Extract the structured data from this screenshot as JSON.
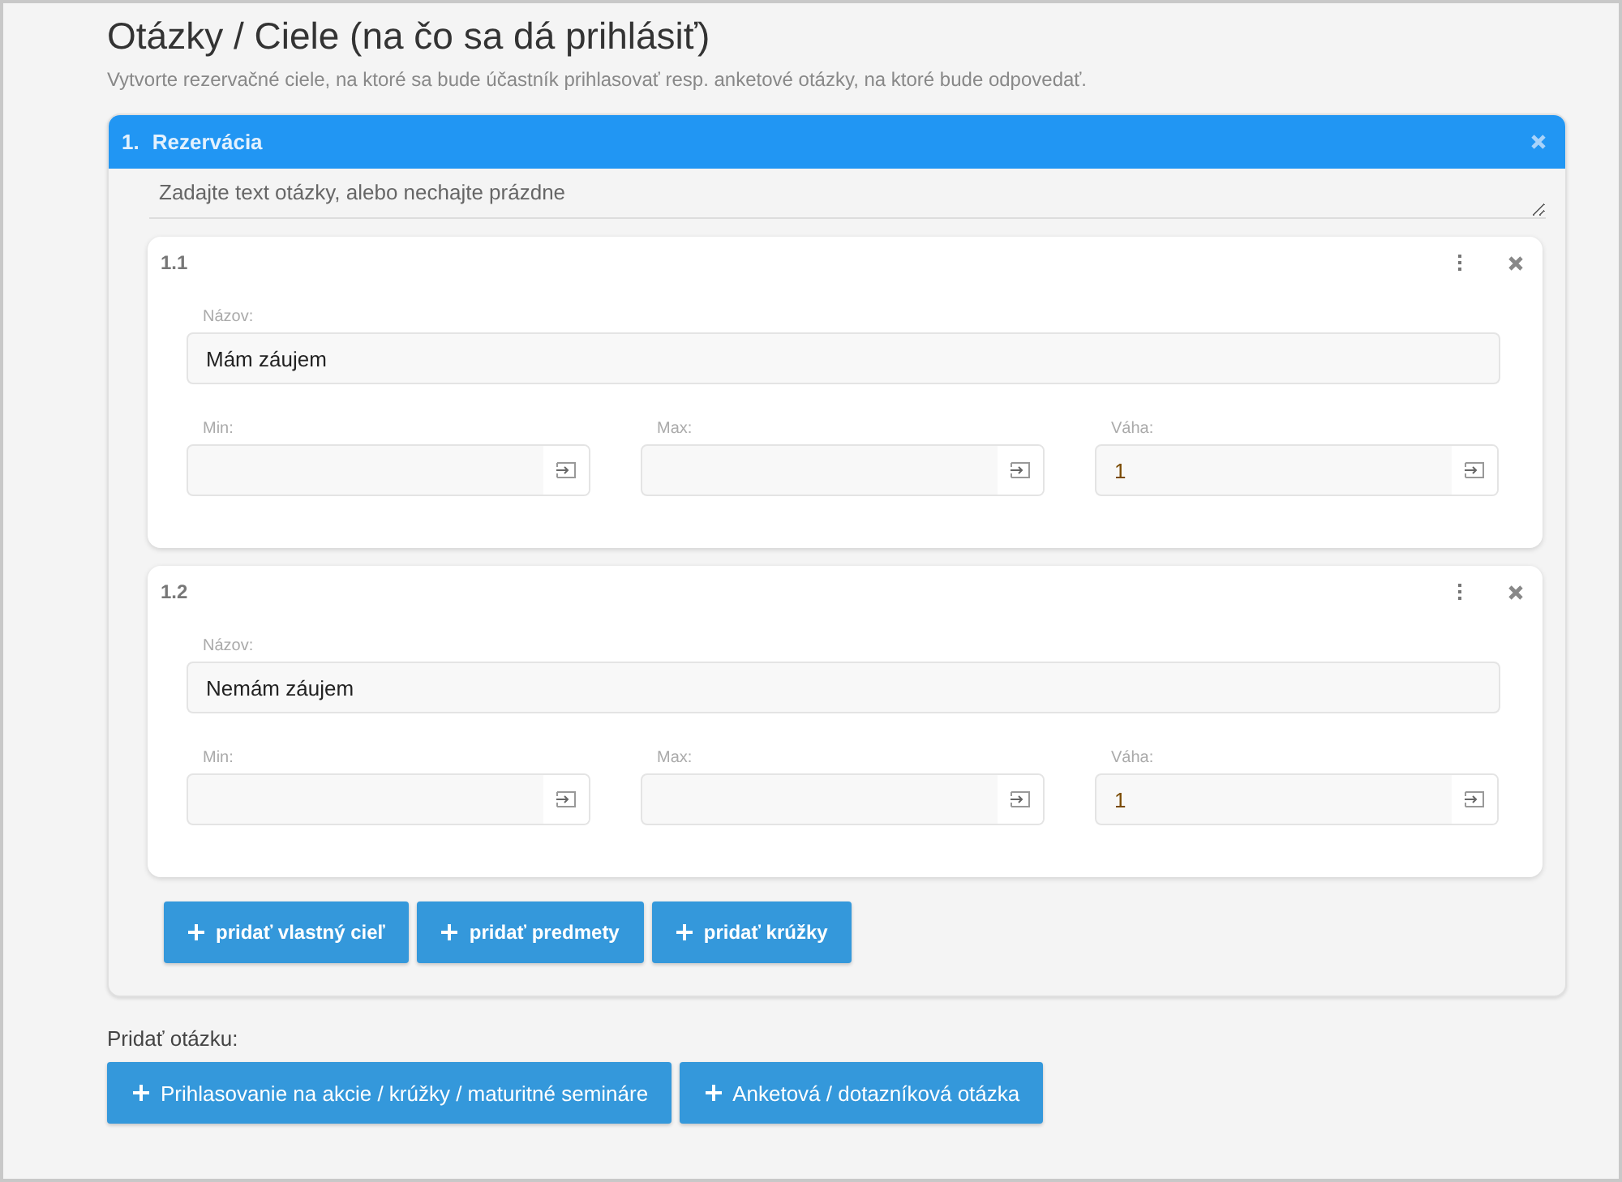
{
  "page": {
    "title": "Otázky / Ciele (na čo sa dá prihlásiť)",
    "subtitle": "Vytvorte rezervačné ciele, na ktoré sa bude účastník prihlasovať resp. anketové otázky, na ktoré bude odpovedať."
  },
  "questions": [
    {
      "number": "1.",
      "title": "Rezervácia",
      "text_placeholder": "Zadajte text otázky, alebo nechajte prázdne",
      "targets": [
        {
          "number": "1.1",
          "name_label": "Názov:",
          "name_value": "Mám záujem",
          "fields": [
            {
              "label": "Min:"
            },
            {
              "label": "Max:"
            },
            {
              "label": "Váha:",
              "value": "1"
            }
          ]
        },
        {
          "number": "1.2",
          "name_label": "Názov:",
          "name_value": "Nemám záujem",
          "fields": [
            {
              "label": "Min:"
            },
            {
              "label": "Max:"
            },
            {
              "label": "Váha:",
              "value": "1"
            }
          ]
        }
      ],
      "add_buttons": [
        "pridať vlastný cieľ",
        "pridať predmety",
        "pridať krúžky"
      ]
    }
  ],
  "add_question": {
    "label": "Pridať otázku:",
    "buttons": [
      "Prihlasovanie na akcie / krúžky / maturitné semináre",
      "Anketová / dotazníková otázka"
    ]
  }
}
